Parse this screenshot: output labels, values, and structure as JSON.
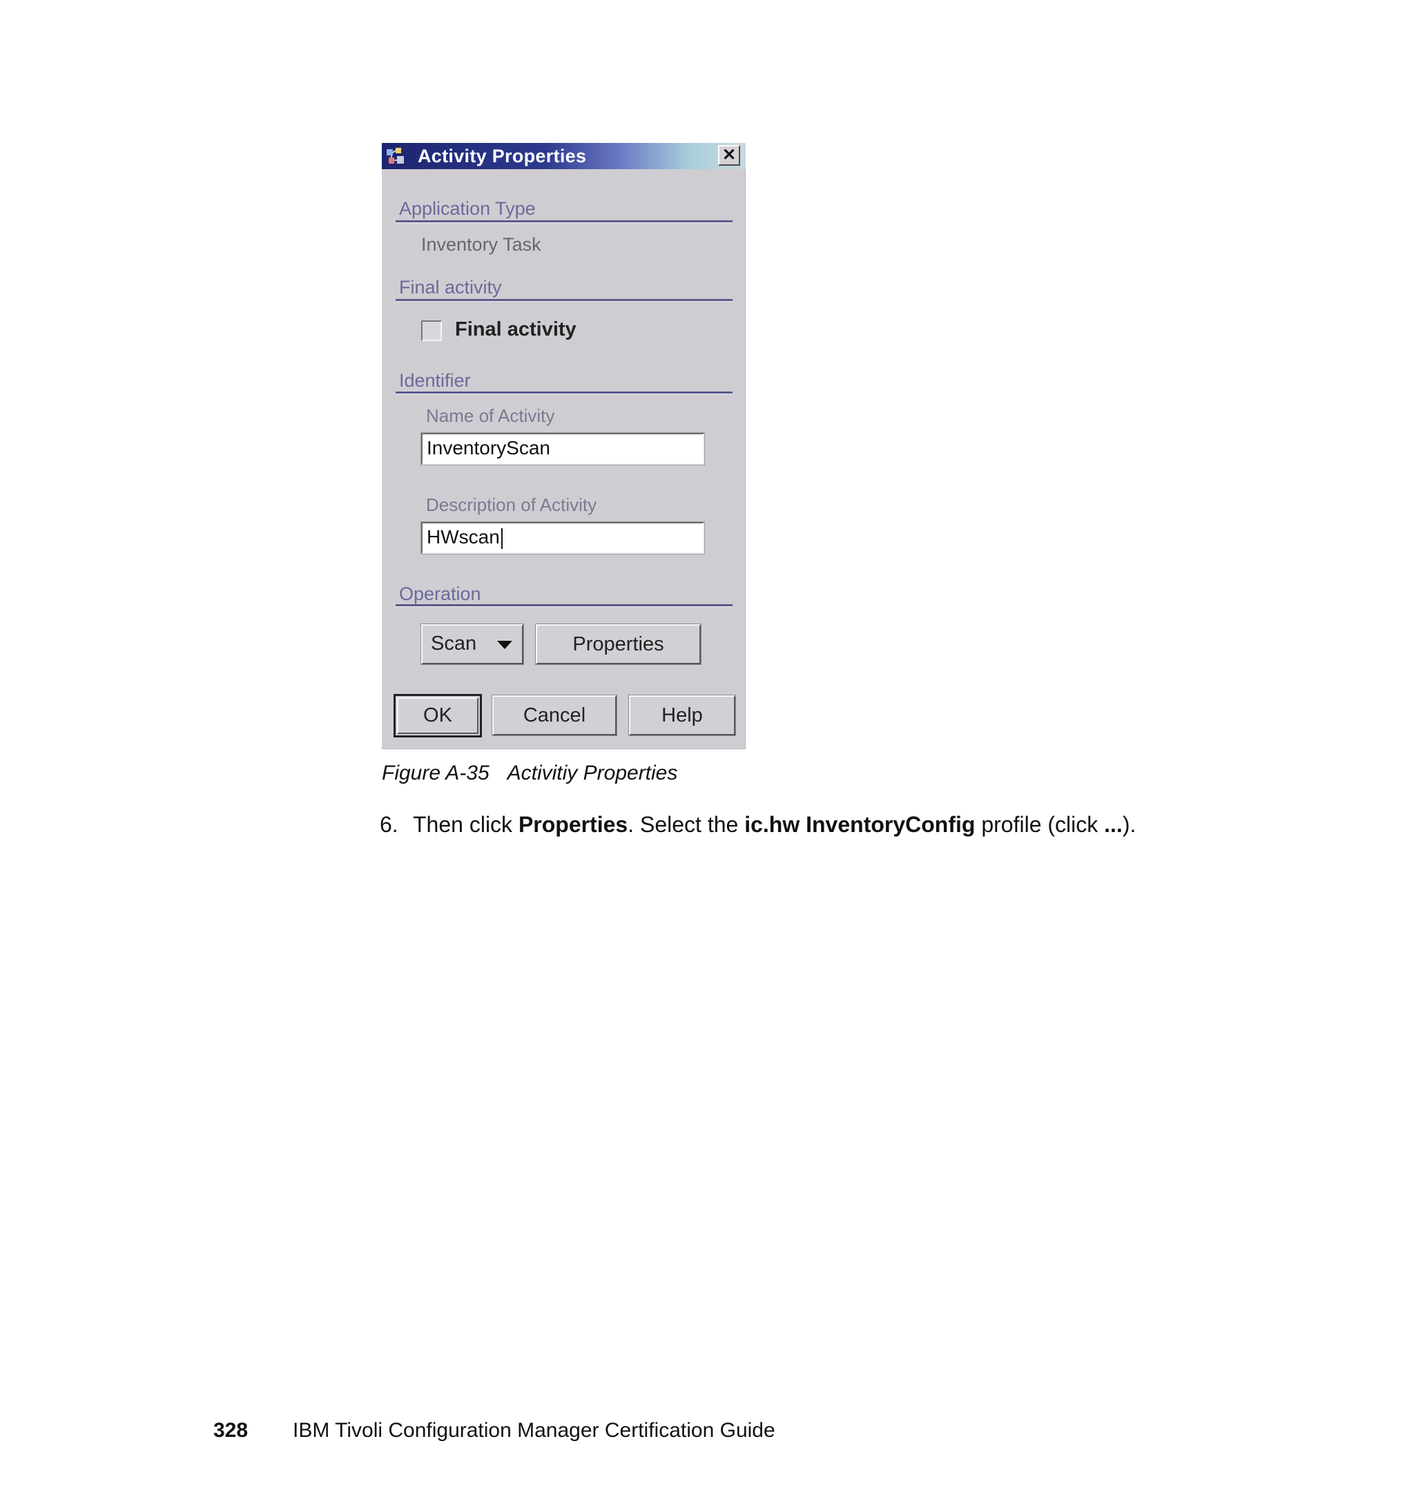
{
  "dialog": {
    "title": "Activity Properties",
    "close_glyph": "✕",
    "sections": {
      "application_type": {
        "label": "Application Type",
        "value": "Inventory Task"
      },
      "final_activity": {
        "label": "Final activity",
        "checkbox_label": "Final activity",
        "checked": false
      },
      "identifier": {
        "label": "Identifier",
        "name_label": "Name of Activity",
        "name_value": "InventoryScan",
        "description_label": "Description of Activity",
        "description_value": "HWscan"
      },
      "operation": {
        "label": "Operation",
        "selected": "Scan",
        "properties_button": "Properties"
      }
    },
    "buttons": {
      "ok": "OK",
      "cancel": "Cancel",
      "help": "Help"
    }
  },
  "caption": {
    "figure": "Figure A-35",
    "title": "Activitiy Properties"
  },
  "step": {
    "number": "6.",
    "text_1": "Then click ",
    "bold_1": "Properties",
    "text_2": ". Select the ",
    "bold_2": "ic.hw InventoryConfig",
    "text_3": " profile (click ",
    "bold_3": "...",
    "text_4": ")."
  },
  "footer": {
    "page_number": "328",
    "book_title": "IBM Tivoli Configuration Manager Certification Guide"
  },
  "colors": {
    "titlebar_dark": "#1d2470",
    "dialog_bg": "#cfcdd2",
    "section_rule": "#5a5a8c"
  },
  "icons": {
    "title_icon": "activity-app-icon",
    "close": "close-icon",
    "combo": "dropdown-arrow-icon"
  }
}
